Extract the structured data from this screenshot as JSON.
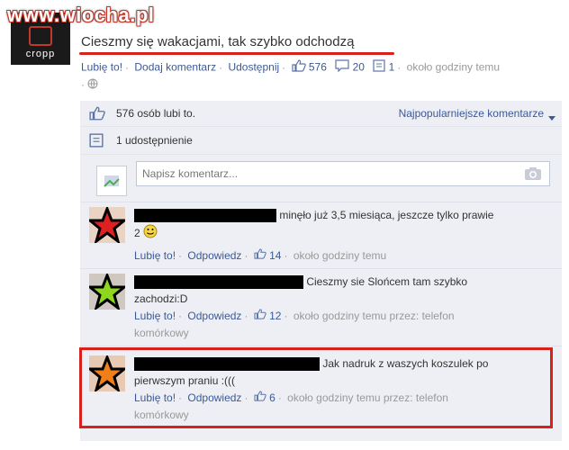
{
  "watermark": "www.wiocha.pl",
  "page": {
    "logo_text": "cropp"
  },
  "post": {
    "text": "Cieszmy się wakacjami, tak szybko odchodzą",
    "like_label": "Lubię to!",
    "comment_label": "Dodaj komentarz",
    "share_label": "Udostępnij",
    "likes_count": "576",
    "comments_count": "20",
    "shares_count": "1",
    "time": "około godziny temu"
  },
  "feedback": {
    "likes_text": "576 osób lubi to.",
    "sort_label": "Najpopularniejsze komentarze",
    "shares_text": "1 udostępnienie",
    "comment_placeholder": "Napisz komentarz..."
  },
  "comments": [
    {
      "text_line1": "minęło już 3,5 miesiąca, jeszcze tylko prawie",
      "text_line2": "2",
      "like_label": "Lubię to!",
      "reply_label": "Odpowiedz",
      "likes": "14",
      "meta": "około godziny temu",
      "star_color": "#e02020"
    },
    {
      "text_line1": "Cieszmy sie Slońcem tam szybko",
      "text_line2": "zachodzi:D",
      "like_label": "Lubię to!",
      "reply_label": "Odpowiedz",
      "likes": "12",
      "meta": "około godziny temu przez: telefon",
      "meta2": "komórkowy",
      "star_color": "#8fd61f"
    },
    {
      "text_line1": "Jak nadruk z waszych koszulek po",
      "text_line2": "pierwszym praniu :(((",
      "like_label": "Lubię to!",
      "reply_label": "Odpowiedz",
      "likes": "6",
      "meta": "około godziny temu przez: telefon",
      "meta2": "komórkowy",
      "star_color": "#f07f1a"
    }
  ],
  "colors": {
    "link": "#3b5998",
    "highlight": "#d8211d",
    "feedback_bg": "#edeff4"
  }
}
